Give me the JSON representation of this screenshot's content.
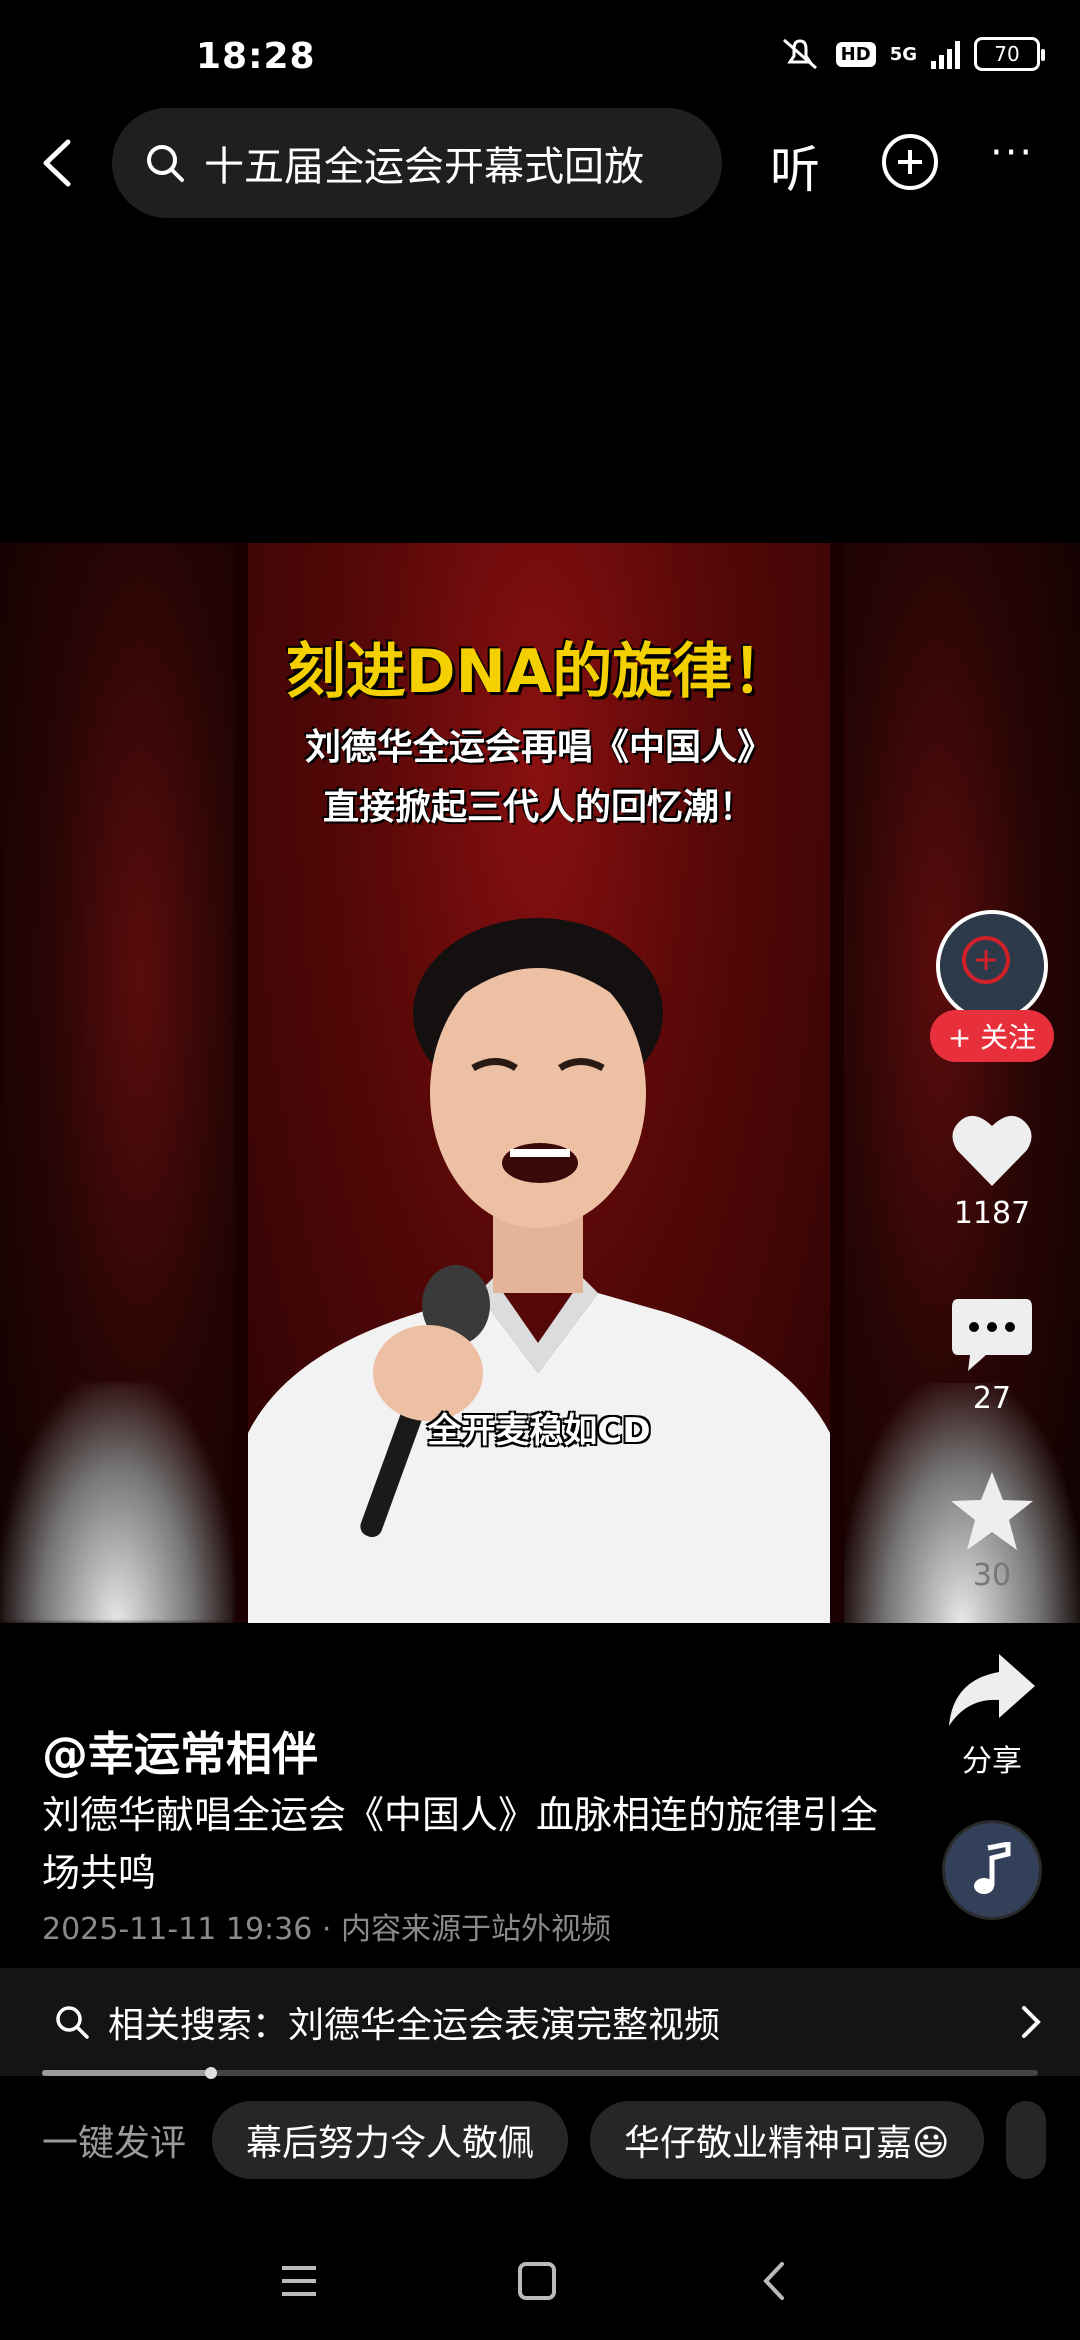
{
  "status_bar": {
    "time": "18:28",
    "hd": "HD",
    "network": "5G",
    "battery": "70"
  },
  "top_nav": {
    "search_text": "十五届全运会开幕式回放",
    "listen_label": "听",
    "more_label": "···"
  },
  "video": {
    "caption_line1": "刻进DNA的旋律！",
    "caption_line2": "刘德华全运会再唱《中国人》",
    "caption_line3": "直接掀起三代人的回忆潮！",
    "subtitle": "全开麦稳如CD"
  },
  "actions": {
    "follow_label": "+ 关注",
    "like_count": "1187",
    "comment_count": "27",
    "favorite_count": "30",
    "share_label": "分享"
  },
  "post": {
    "author": "@幸运常相伴",
    "description": "刘德华献唱全运会《中国人》血脉相连的旋律引全场共鸣",
    "meta": "2025-11-11 19:36 · 内容来源于站外视频"
  },
  "related_search": {
    "text": "相关搜索：刘德华全运会表演完整视频"
  },
  "progress": {
    "fraction": 0.17
  },
  "quick_comment": {
    "label": "一键发评",
    "chips": [
      "幕后努力令人敬佩",
      "华仔敬业精神可嘉😃"
    ]
  },
  "icons": {
    "back": "chevron-left-icon",
    "search": "search-icon",
    "add": "plus-circle-icon",
    "like": "heart-icon",
    "comment": "comment-bubble-icon",
    "favorite": "star-icon",
    "share": "share-arrow-icon",
    "music": "music-note-icon"
  },
  "colors": {
    "follow": "#e8303c",
    "caption_yellow": "#f5d000",
    "background": "#000000"
  }
}
